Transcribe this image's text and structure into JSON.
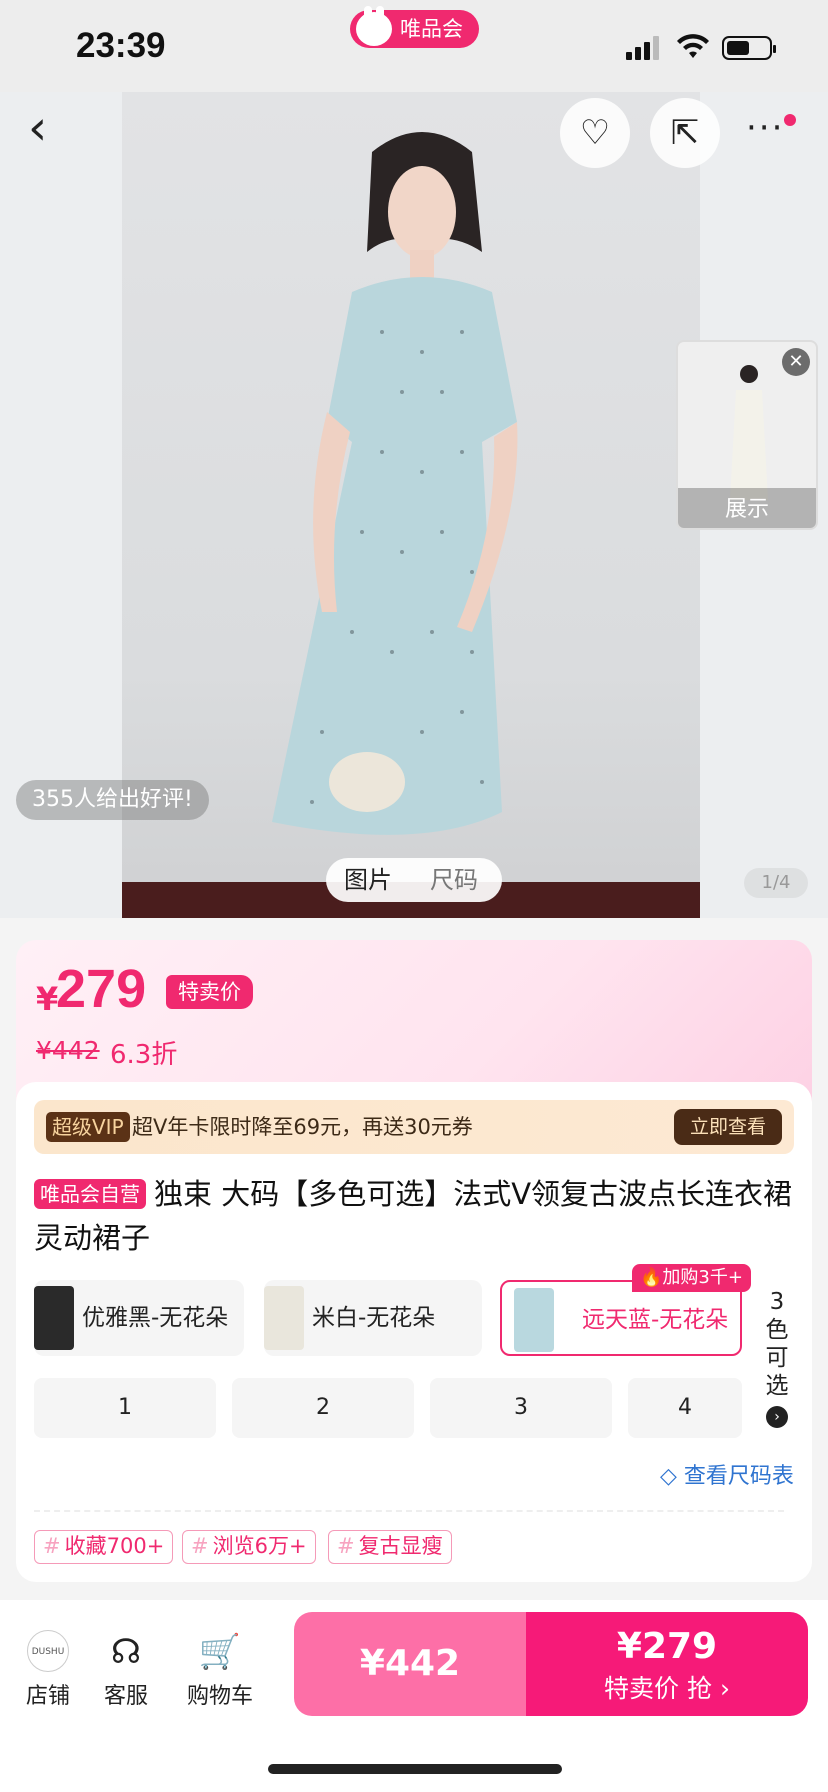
{
  "status_bar": {
    "time": "23:39",
    "app_pill": "唯品会",
    "signal_icon": "signal-bars-icon",
    "wifi_icon": "wifi-icon",
    "battery_icon": "battery-icon"
  },
  "hero": {
    "back_icon": "chevron-left-icon",
    "favorite_icon": "heart-plus-icon",
    "share_icon": "share-icon",
    "more_icon": "more-dots-icon",
    "mini_thumb_label": "展示",
    "review_text": "355人给出好评!",
    "segments": [
      "图片",
      "尺码"
    ],
    "page_indicator": "1/4"
  },
  "price": {
    "currency": "¥",
    "current": "279",
    "sale_tag": "特卖价",
    "original": "¥442",
    "discount": "6.3折"
  },
  "vip_banner": {
    "badge": "超级VIP",
    "text": "超V年卡限时降至69元，再送30元券",
    "button": "立即查看"
  },
  "product": {
    "self_tag": "唯品会自营",
    "title": "独束 大码【多色可选】法式V领复古波点长连衣裙灵动裙子"
  },
  "colors": {
    "options": [
      {
        "name": "优雅黑-无花朵",
        "swatch": "#2a2a2a"
      },
      {
        "name": "米白-无花朵",
        "swatch": "#e9e6dc"
      },
      {
        "name": "远天蓝-无花朵",
        "swatch": "#b9d8df"
      }
    ],
    "selected_index": 2,
    "hot_badge": "加购3千+",
    "more_label": "3色可选"
  },
  "sizes": [
    "1",
    "2",
    "3",
    "4"
  ],
  "size_chart_link": "查看尺码表",
  "tags": [
    "收藏700+",
    "浏览6万+",
    "复古显瘦"
  ],
  "bottom_nav": {
    "shop_logo": "DUSHU",
    "items": [
      {
        "label": "店铺",
        "icon": "shop-icon"
      },
      {
        "label": "客服",
        "icon": "headset-icon"
      },
      {
        "label": "购物车",
        "icon": "cart-icon"
      }
    ],
    "original_buy_price": "¥442",
    "sale_buy_price": "¥279",
    "sale_buy_label": "特卖价 抢 ›"
  },
  "colors_theme": {
    "accent": "#f0296f",
    "buy_right": "#f61a78",
    "buy_left": "#fd6fa7",
    "link": "#2f74d0"
  }
}
